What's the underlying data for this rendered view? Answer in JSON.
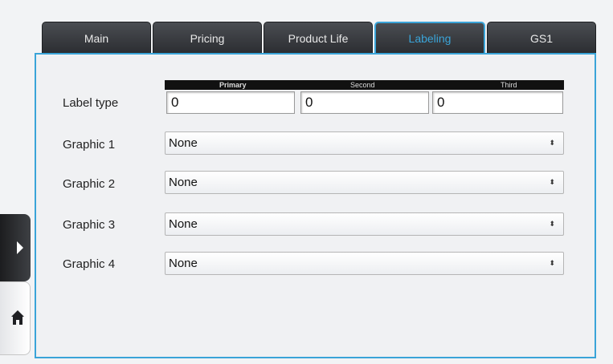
{
  "tabs": [
    {
      "label": "Main"
    },
    {
      "label": "Pricing"
    },
    {
      "label": "Product Life"
    },
    {
      "label": "Labeling"
    },
    {
      "label": "GS1"
    }
  ],
  "active_tab": "Labeling",
  "label_type": {
    "label": "Label type",
    "columns": [
      "Primary",
      "Second",
      "Third"
    ],
    "values": [
      "0",
      "0",
      "0"
    ]
  },
  "graphics": [
    {
      "label": "Graphic 1",
      "value": "None"
    },
    {
      "label": "Graphic 2",
      "value": "None"
    },
    {
      "label": "Graphic 3",
      "value": "None"
    },
    {
      "label": "Graphic 4",
      "value": "None"
    }
  ],
  "select_arrow": "⬍",
  "side_nav": {
    "expand_icon": "play-arrow-icon",
    "home_icon": "home-icon"
  },
  "colors": {
    "accent": "#3aa4d8",
    "tab_bg": "#2b2d31"
  }
}
